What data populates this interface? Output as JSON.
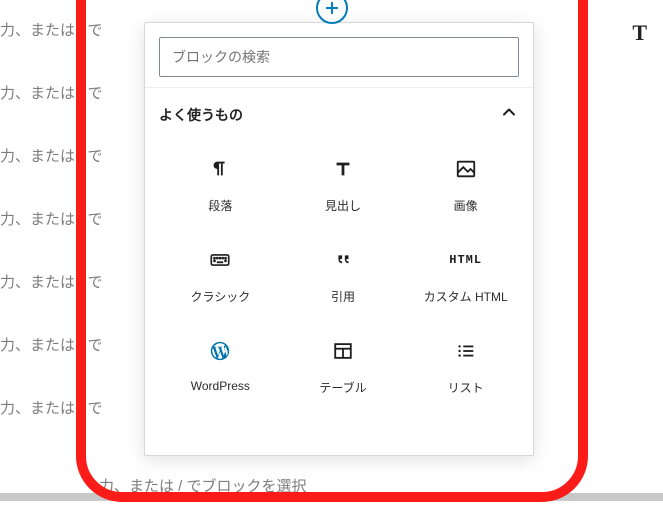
{
  "background": {
    "placeholder_fragment": "力、または / で",
    "full_placeholder": "力、または / でブロックを選択"
  },
  "shortcut_glyph": "T",
  "search": {
    "placeholder": "ブロックの検索"
  },
  "section": {
    "title": "よく使うもの"
  },
  "blocks": [
    {
      "key": "paragraph",
      "label": "段落",
      "icon": "pilcrow-icon"
    },
    {
      "key": "heading",
      "label": "見出し",
      "icon": "heading-t-icon"
    },
    {
      "key": "image",
      "label": "画像",
      "icon": "image-icon"
    },
    {
      "key": "classic",
      "label": "クラシック",
      "icon": "keyboard-icon"
    },
    {
      "key": "quote",
      "label": "引用",
      "icon": "quote-icon"
    },
    {
      "key": "custom-html",
      "label": "カスタム HTML",
      "icon": "html-icon"
    },
    {
      "key": "wordpress",
      "label": "WordPress",
      "icon": "wordpress-icon"
    },
    {
      "key": "table",
      "label": "テーブル",
      "icon": "table-icon"
    },
    {
      "key": "list",
      "label": "リスト",
      "icon": "list-icon"
    }
  ]
}
